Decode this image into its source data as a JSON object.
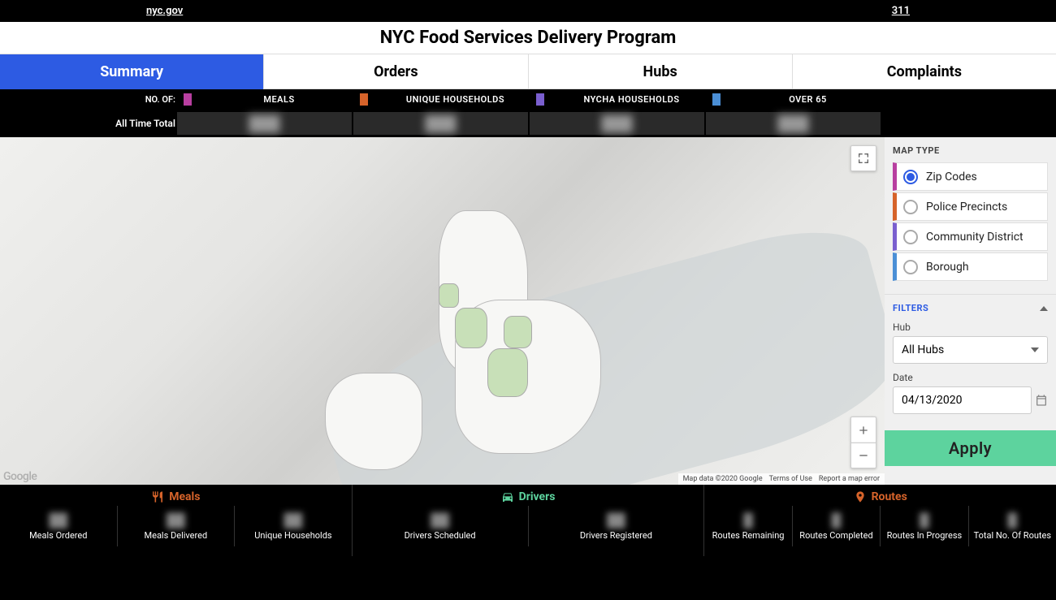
{
  "topbar": {
    "left": "nyc.gov",
    "right": "311"
  },
  "title": "NYC Food Services Delivery Program",
  "tabs": [
    {
      "label": "Summary",
      "active": true
    },
    {
      "label": "Orders",
      "active": false
    },
    {
      "label": "Hubs",
      "active": false
    },
    {
      "label": "Complaints",
      "active": false
    }
  ],
  "stat_header": {
    "label": "NO. OF:",
    "cols": [
      {
        "label": "MEALS",
        "color": "#b83fa0"
      },
      {
        "label": "UNIQUE HOUSEHOLDS",
        "color": "#d6632a"
      },
      {
        "label": "NYCHA HOUSEHOLDS",
        "color": "#7a5fcf"
      },
      {
        "label": "OVER 65",
        "color": "#4b8fd6"
      }
    ]
  },
  "stat_row": {
    "label": "All Time Total",
    "values": [
      "███",
      "███",
      "███",
      "███"
    ]
  },
  "map": {
    "attribution": "Map data ©2020 Google",
    "terms": "Terms of Use",
    "report": "Report a map error",
    "logo": "Google"
  },
  "sidebar": {
    "map_type_title": "MAP TYPE",
    "map_types": [
      {
        "label": "Zip Codes",
        "color": "#b83fa0",
        "selected": true
      },
      {
        "label": "Police Precincts",
        "color": "#d6632a",
        "selected": false
      },
      {
        "label": "Community District",
        "color": "#7a5fcf",
        "selected": false
      },
      {
        "label": "Borough",
        "color": "#4b8fd6",
        "selected": false
      }
    ],
    "filters_title": "FILTERS",
    "hub_label": "Hub",
    "hub_value": "All Hubs",
    "date_label": "Date",
    "date_value": "04/13/2020",
    "apply": "Apply"
  },
  "bottom": {
    "sections": [
      {
        "title": "Meals",
        "color": "#d6632a",
        "icon": "utensils",
        "cells": [
          {
            "label": "Meals Ordered"
          },
          {
            "label": "Meals Delivered"
          },
          {
            "label": "Unique Households"
          }
        ]
      },
      {
        "title": "Drivers",
        "color": "#5dd39e",
        "icon": "car",
        "cells": [
          {
            "label": "Drivers Scheduled"
          },
          {
            "label": "Drivers Registered"
          }
        ]
      },
      {
        "title": "Routes",
        "color": "#d6632a",
        "icon": "route",
        "cells": [
          {
            "label": "Routes Remaining"
          },
          {
            "label": "Routes Completed"
          },
          {
            "label": "Routes In Progress"
          },
          {
            "label": "Total No. Of Routes"
          }
        ]
      }
    ]
  }
}
